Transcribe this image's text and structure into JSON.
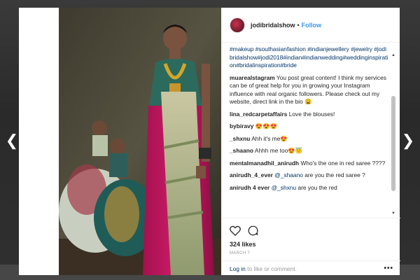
{
  "post": {
    "username": "jodibridalshow",
    "dot": "•",
    "follow_label": "Follow",
    "caption_tags": "#makeup #southasianfashion #indianjewellery #jewelry #jodibridalshow#jodi2018#indian#indianwedding#weddinginspiration#bridalinspiration#bride",
    "likes": "324 likes",
    "date": "MARCH 7"
  },
  "comments": [
    {
      "user": "muarealstagram",
      "text": "You post great content! I think my services can be of great help for you in growing your Instagram influence with real organic followers. Please check out my website, direct link in the bio 😩"
    },
    {
      "user": "lina_redcarpetaffairs",
      "text": "Love the blouses!"
    },
    {
      "user": "bybiravy",
      "text": "😍😍😍"
    },
    {
      "user": "_shxnu",
      "text": "Ahh it's me😍"
    },
    {
      "user": "_shaano",
      "text": "Ahhh me too😍😇"
    },
    {
      "user": "mentalmanadhil_anirudh",
      "text": "Who's the one in red saree ????"
    },
    {
      "user": "anirudh_4_ever",
      "mention": "@_shaano",
      "text": "are you the red saree ?"
    },
    {
      "user": "anirudh 4 ever",
      "mention": "@_shxnu",
      "text": "are you the red"
    }
  ],
  "footer": {
    "login_link": "Log in",
    "login_rest": "to like or comment.",
    "more": "•••"
  },
  "icons": {
    "prev": "chevron-left-icon",
    "next": "chevron-right-icon",
    "like": "heart-icon",
    "comment": "comment-bubble-icon"
  },
  "colors": {
    "link": "#3897f0",
    "tag": "#003569",
    "muted": "#999999"
  }
}
